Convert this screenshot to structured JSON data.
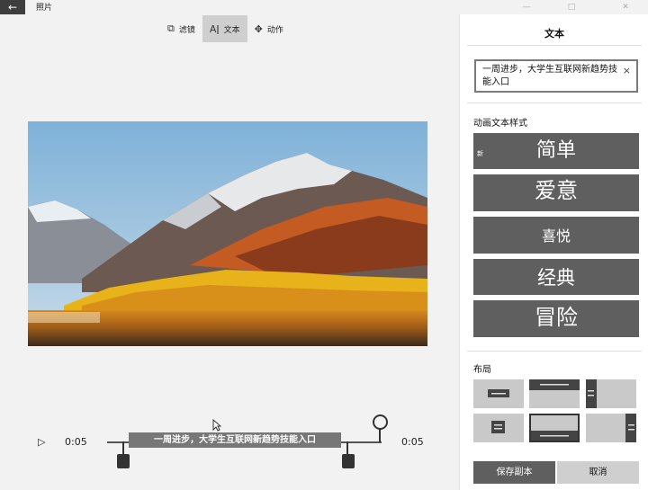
{
  "app": {
    "title": "照片",
    "back_icon": "←"
  },
  "window_controls": {
    "minimize": "—",
    "maximize": "□",
    "close": "✕"
  },
  "toolbar": {
    "items": [
      {
        "label": "滤镜",
        "icon": "filter-icon",
        "glyph": "⧉",
        "active": false
      },
      {
        "label": "文本",
        "icon": "text-icon",
        "glyph": "Aǀ",
        "active": true
      },
      {
        "label": "动作",
        "icon": "motion-icon",
        "glyph": "✥",
        "active": false
      }
    ]
  },
  "timeline": {
    "play_icon": "▷",
    "start_time": "0:05",
    "end_time": "0:05",
    "caption_text": "一周进步，大学生互联网新趋势技能入口"
  },
  "panel": {
    "title": "文本",
    "text_value": "一周进步，大学生互联网新趋势技能入口",
    "clear_icon": "×",
    "styles_label": "动画文本样式",
    "styles": [
      {
        "label": "简单",
        "badge": "新"
      },
      {
        "label": "爱意",
        "badge": ""
      },
      {
        "label": "喜悦",
        "badge": ""
      },
      {
        "label": "经典",
        "badge": ""
      },
      {
        "label": "冒险",
        "badge": ""
      }
    ],
    "layout_label": "布局",
    "save_label": "保存副本",
    "cancel_label": "取消"
  }
}
